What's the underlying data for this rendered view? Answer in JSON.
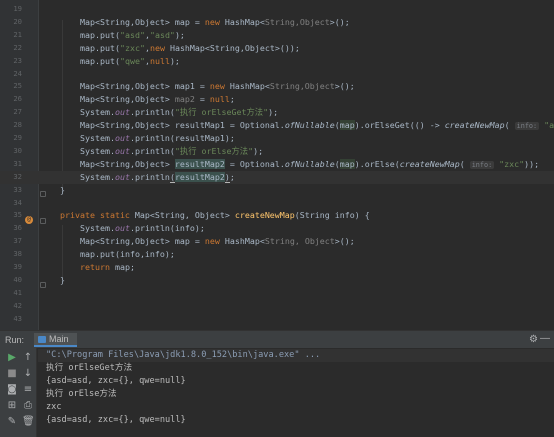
{
  "editor": {
    "lines": [
      {
        "n": "19",
        "html": ""
      },
      {
        "n": "20",
        "html": "<span>Map&lt;String,Object&gt; map = </span><span class='kw'>new</span><span> HashMap&lt;</span><span style='color:#808080'>String,Object</span><span>&gt;();</span>"
      },
      {
        "n": "21",
        "html": "<span>map.put(</span><span class='str'>\"asd\"</span><span>,</span><span class='str'>\"asd\"</span><span>);</span>"
      },
      {
        "n": "22",
        "html": "<span>map.put(</span><span class='str'>\"zxc\"</span><span>,</span><span class='kw'>new</span><span> HashMap&lt;String,Object&gt;());</span>"
      },
      {
        "n": "23",
        "html": "<span>map.put(</span><span class='str'>\"qwe\"</span><span>,</span><span class='kw'>null</span><span>);</span>"
      },
      {
        "n": "24",
        "html": ""
      },
      {
        "n": "25",
        "html": "<span>Map&lt;String,Object&gt; map1 = </span><span class='kw'>new</span><span> HashMap&lt;</span><span style='color:#808080'>String,Object</span><span>&gt;();</span>"
      },
      {
        "n": "26",
        "html": "<span>Map&lt;String,Object&gt; </span><span style='color:#808080'>map2</span><span> = </span><span class='kw'>null</span><span>;</span>"
      },
      {
        "n": "27",
        "html": "<span>System.</span><span class='fld'>out</span><span>.println(</span><span class='str'>\"执行 orElseGet方法\"</span><span>);</span>"
      },
      {
        "n": "28",
        "html": "<span>Map&lt;String,Object&gt; resultMap1 = Optional.</span><span class='it'>ofNullable</span><span>(</span><span class='hl'>map</span><span>).orElseGet(() -&gt; </span><span class='it'>createNewMap</span><span>( </span><span class='hint'>info:</span><span class='str'> \"asd\"</span><span>))</span>"
      },
      {
        "n": "29",
        "html": "<span>System.</span><span class='fld'>out</span><span>.println(resultMap1);</span>"
      },
      {
        "n": "30",
        "html": "<span>System.</span><span class='fld'>out</span><span>.println(</span><span class='str'>\"执行 orElse方法\"</span><span>);</span>"
      },
      {
        "n": "31",
        "html": "<span>Map&lt;String,Object&gt; </span><span class='hl2'>resultMap2</span><span> = Optional.</span><span class='it'>ofNullable</span><span>(</span><span class='hl'>map</span><span>).orElse(</span><span class='it'>createNewMap</span><span>( </span><span class='hint'>info:</span><span class='str'> \"zxc\"</span><span>));</span>"
      },
      {
        "n": "32",
        "html": "<span>System.</span><span class='fld'>out</span><span>.println</span><span class='br'>(</span><span class='hl2'>resultMap2</span><span class='br'>)</span><span>;</span>"
      },
      {
        "n": "33",
        "html": "<span>}</span>"
      },
      {
        "n": "34",
        "html": ""
      },
      {
        "n": "35",
        "html": "<span class='kw'>private static</span><span> Map&lt;String, Object&gt; </span><span class='fn'>createNewMap</span><span>(String info) {</span>"
      },
      {
        "n": "36",
        "html": "<span>System.</span><span class='fld'>out</span><span>.println(info);</span>"
      },
      {
        "n": "37",
        "html": "<span>Map&lt;String,Object&gt; map = </span><span class='kw'>new</span><span> HashMap&lt;</span><span style='color:#808080'>String, Object</span><span>&gt;();</span>"
      },
      {
        "n": "38",
        "html": "<span>map.put(info,info);</span>"
      },
      {
        "n": "39",
        "html": "<span class='kw'>return</span><span> map;</span>"
      },
      {
        "n": "40",
        "html": "<span>}</span>"
      },
      {
        "n": "41",
        "html": ""
      },
      {
        "n": "42",
        "html": ""
      },
      {
        "n": "43",
        "html": ""
      }
    ]
  },
  "run_panel": {
    "label": "Run:",
    "tab": "Main",
    "gear": "⚙",
    "minimize": "—",
    "console": [
      "\"C:\\Program Files\\Java\\jdk1.8.0_152\\bin\\java.exe\" ...",
      "执行 orElseGet方法",
      "{asd=asd, zxc={}, qwe=null}",
      "执行 orElse方法",
      "zxc",
      "{asd=asd, zxc={}, qwe=null}"
    ]
  },
  "toolbar_icons": [
    "rerun-icon",
    "stop-icon",
    "screenshot-icon",
    "settings-icon",
    "pin-icon",
    "print-icon",
    "trash-icon"
  ]
}
